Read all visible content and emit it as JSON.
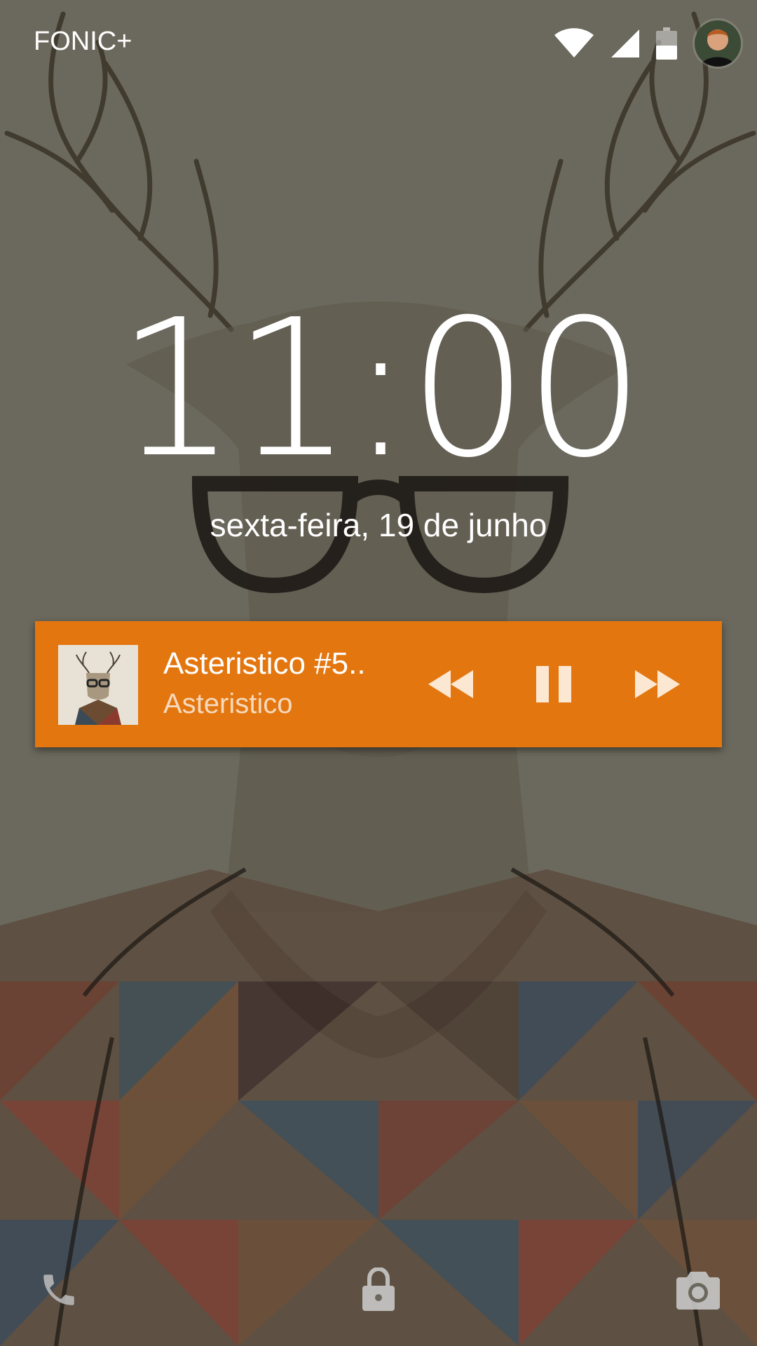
{
  "status_bar": {
    "carrier": "FONIC+",
    "icons": [
      "wifi-icon",
      "cell-signal-icon",
      "battery-icon",
      "user-avatar"
    ]
  },
  "clock": {
    "time": "11:00",
    "date": "sexta-feira, 19 de junho"
  },
  "media": {
    "title": "Asteristico #5..",
    "artist": "Asteristico",
    "controls": [
      "rewind-icon",
      "pause-icon",
      "fast-forward-icon"
    ],
    "card_color": "#e3760f"
  },
  "bottom_bar": {
    "icons": [
      "phone-icon",
      "lock-icon",
      "camera-icon"
    ]
  }
}
